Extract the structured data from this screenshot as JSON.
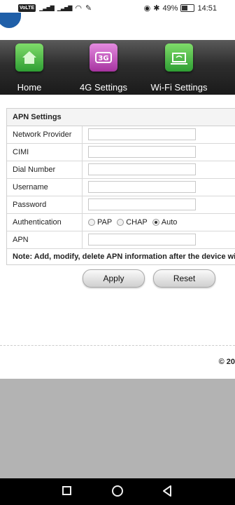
{
  "status_bar": {
    "volte": "VoLTE",
    "battery": "49%",
    "time": "14:51"
  },
  "nav": {
    "items": [
      {
        "label": "Home",
        "icon": "home-icon"
      },
      {
        "label": "4G Settings",
        "icon": "3g-icon"
      },
      {
        "label": "Wi-Fi Settings",
        "icon": "laptop-wifi-icon"
      }
    ]
  },
  "apn": {
    "title": "APN Settings",
    "fields": {
      "network_provider": {
        "label": "Network Provider",
        "value": ""
      },
      "cimi": {
        "label": "CIMI",
        "value": ""
      },
      "dial_number": {
        "label": "Dial Number",
        "value": ""
      },
      "username": {
        "label": "Username",
        "value": ""
      },
      "password": {
        "label": "Password",
        "value": ""
      },
      "apn": {
        "label": "APN",
        "value": ""
      }
    },
    "authentication": {
      "label": "Authentication",
      "options": [
        "PAP",
        "CHAP",
        "Auto"
      ],
      "selected": "Auto"
    },
    "note": "Note: Add, modify, delete APN information after the device will a"
  },
  "buttons": {
    "apply": "Apply",
    "reset": "Reset"
  },
  "footer": {
    "copyright": "© 20"
  },
  "colors": {
    "nav_bg": "#2e2e2e",
    "icon_green": "#2e9e33",
    "icon_purple": "#a6339f",
    "page_gray": "#b3b3b3"
  }
}
